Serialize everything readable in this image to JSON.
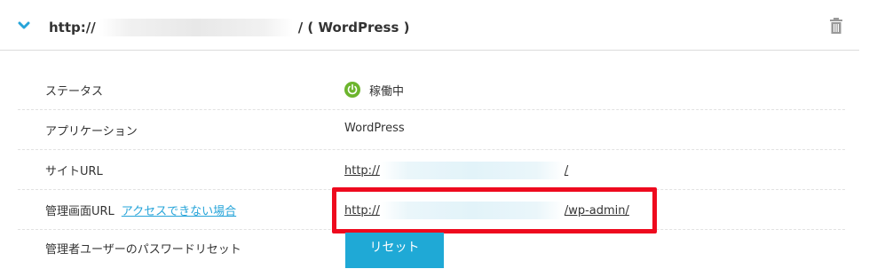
{
  "header": {
    "url_prefix": "http://",
    "url_suffix": "/ ( WordPress )"
  },
  "rows": [
    {
      "label": "ステータス",
      "value": "稼働中"
    },
    {
      "label": "アプリケーション",
      "value": "WordPress"
    },
    {
      "label": "サイトURL",
      "value_prefix": "http://",
      "value_suffix": "/"
    },
    {
      "label": "管理画面URL",
      "help_link": "アクセスできない場合",
      "value_prefix": "http://",
      "value_suffix": "/wp-admin/"
    },
    {
      "label": "管理者ユーザーのパスワードリセット",
      "button": "リセット"
    }
  ],
  "colors": {
    "link": "#26a4d9",
    "status_ok": "#6cb52d",
    "highlight": "#ee0a1e",
    "button": "#1fa9d6"
  },
  "icons": [
    "chevron-down-icon",
    "trash-icon",
    "power-status-icon"
  ]
}
